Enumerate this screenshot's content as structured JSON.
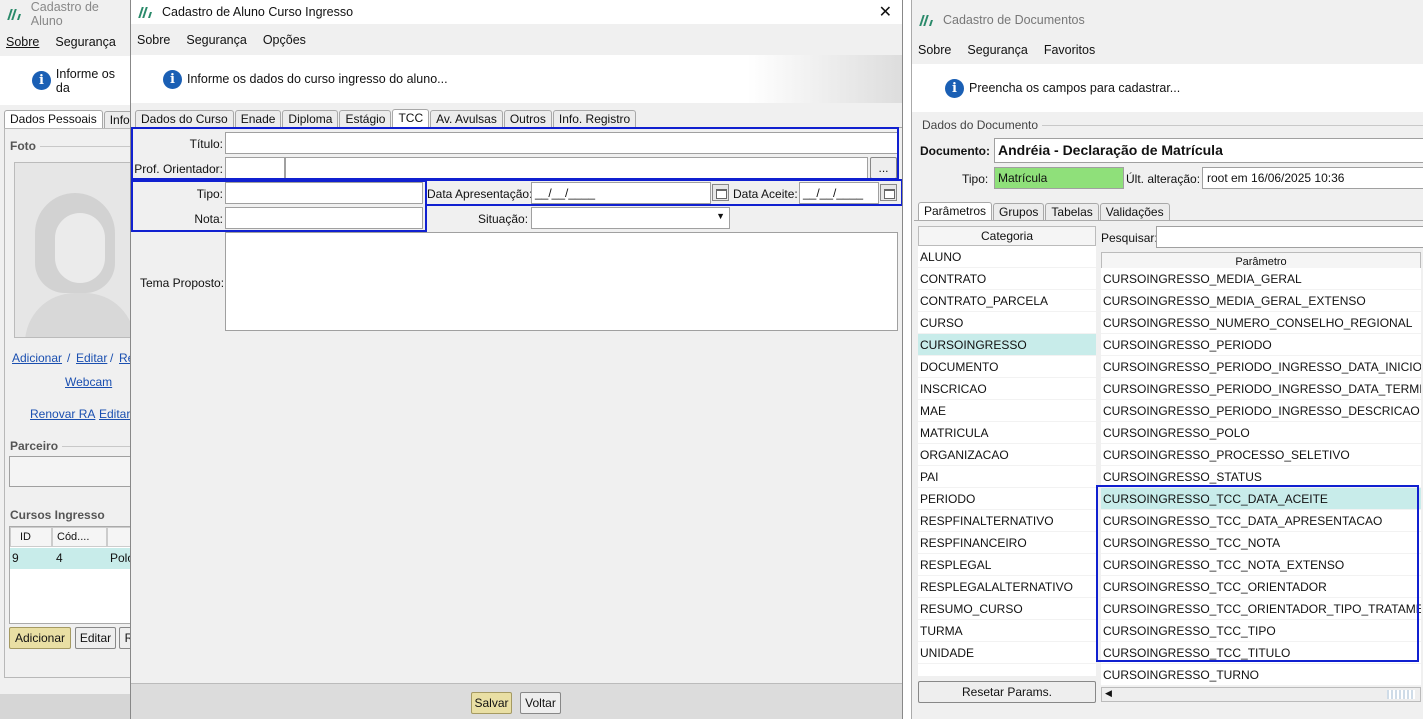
{
  "left_window": {
    "title": "Cadastro de Aluno",
    "menu": [
      "Sobre",
      "Segurança"
    ],
    "info_text": "Informe os da",
    "tabs": [
      "Dados Pessoais",
      "Info."
    ],
    "foto_label": "Foto",
    "links": {
      "adicionar": "Adicionar",
      "editar": "Editar",
      "re": "Re",
      "sep": "/",
      "webcam": "Webcam",
      "renovar_ra": "Renovar RA",
      "editar2": "Editar"
    },
    "parceiro_label": "Parceiro",
    "cursos_label": "Cursos Ingresso",
    "table": {
      "headers": [
        "ID",
        "Cód...."
      ],
      "row": [
        "9",
        "4",
        "Polo"
      ]
    },
    "buttons": {
      "adicionar": "Adicionar",
      "editar": "Editar",
      "r": "R"
    }
  },
  "middle_window": {
    "title": "Cadastro de Aluno Curso Ingresso",
    "close": "✕",
    "menu": [
      "Sobre",
      "Segurança",
      "Opções"
    ],
    "info_text": "Informe os dados do curso ingresso do aluno...",
    "tabs": [
      "Dados do Curso",
      "Enade",
      "Diploma",
      "Estágio",
      "TCC",
      "Av. Avulsas",
      "Outros",
      "Info. Registro"
    ],
    "active_tab": "TCC",
    "form": {
      "titulo_label": "Título:",
      "orientador_label": "Prof. Orientador:",
      "orientador_button": "...",
      "tipo_label": "Tipo:",
      "nota_label": "Nota:",
      "data_apresentacao_label": "Data Apresentação:",
      "data_apresentacao_value": "__/__/____",
      "data_aceite_label": "Data Aceite:",
      "data_aceite_value": "__/__/____",
      "situacao_label": "Situação:",
      "tema_label": "Tema Proposto:"
    },
    "buttons": {
      "salvar": "Salvar",
      "voltar": "Voltar"
    }
  },
  "right_window": {
    "title": "Cadastro de Documentos",
    "menu": [
      "Sobre",
      "Segurança",
      "Favoritos"
    ],
    "info_text": "Preencha os campos para cadastrar...",
    "group_label": "Dados do Documento",
    "documento_label": "Documento:",
    "documento_value": "Andréia - Declaração de Matrícula",
    "tipo_label": "Tipo:",
    "tipo_value": "Matrícula",
    "ult_label": "Últ. alteração:",
    "ult_value": "root em 16/06/2025 10:36",
    "tabs": [
      "Parâmetros",
      "Grupos",
      "Tabelas",
      "Validações"
    ],
    "categoria_header": "Categoria",
    "pesquisar_label": "Pesquisar:",
    "parametro_header": "Parâmetro",
    "categories": [
      "ALUNO",
      "CONTRATO",
      "CONTRATO_PARCELA",
      "CURSO",
      "CURSOINGRESSO",
      "DOCUMENTO",
      "INSCRICAO",
      "MAE",
      "MATRICULA",
      "ORGANIZACAO",
      "PAI",
      "PERIODO",
      "RESPFINALTERNATIVO",
      "RESPFINANCEIRO",
      "RESPLEGAL",
      "RESPLEGALALTERNATIVO",
      "RESUMO_CURSO",
      "TURMA",
      "UNIDADE"
    ],
    "selected_category": "CURSOINGRESSO",
    "parameters": [
      "CURSOINGRESSO_MEDIA_GERAL",
      "CURSOINGRESSO_MEDIA_GERAL_EXTENSO",
      "CURSOINGRESSO_NUMERO_CONSELHO_REGIONAL",
      "CURSOINGRESSO_PERIODO",
      "CURSOINGRESSO_PERIODO_INGRESSO_DATA_INICIO",
      "CURSOINGRESSO_PERIODO_INGRESSO_DATA_TERMINO",
      "CURSOINGRESSO_PERIODO_INGRESSO_DESCRICAO",
      "CURSOINGRESSO_POLO",
      "CURSOINGRESSO_PROCESSO_SELETIVO",
      "CURSOINGRESSO_STATUS",
      "CURSOINGRESSO_TCC_DATA_ACEITE",
      "CURSOINGRESSO_TCC_DATA_APRESENTACAO",
      "CURSOINGRESSO_TCC_NOTA",
      "CURSOINGRESSO_TCC_NOTA_EXTENSO",
      "CURSOINGRESSO_TCC_ORIENTADOR",
      "CURSOINGRESSO_TCC_ORIENTADOR_TIPO_TRATAMENTO",
      "CURSOINGRESSO_TCC_TIPO",
      "CURSOINGRESSO_TCC_TITULO",
      "CURSOINGRESSO_TURNO"
    ],
    "selected_parameter": "CURSOINGRESSO_TCC_DATA_ACEITE",
    "reset_button": "Resetar Params."
  },
  "colors": {
    "highlight": "#1020d0",
    "selection": "#c8ecea",
    "tipo_green": "#8fe07a",
    "yellow_button": "#e9dfa4"
  }
}
